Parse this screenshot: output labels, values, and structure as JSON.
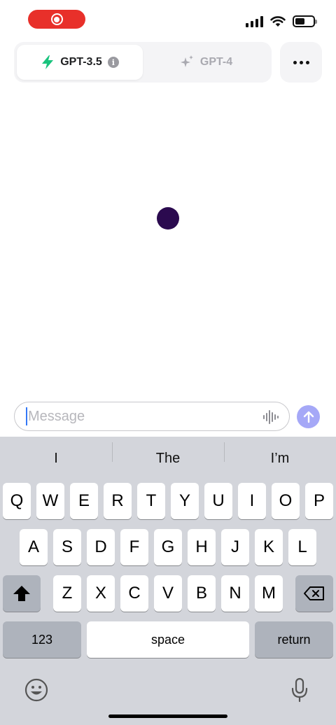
{
  "status": {
    "battery_level": 0.55
  },
  "models": {
    "active": {
      "label": "GPT-3.5",
      "icon": "bolt-icon",
      "color": "#19c37d"
    },
    "inactive": {
      "label": "GPT-4",
      "icon": "sparkles-icon"
    }
  },
  "composer": {
    "placeholder": "Message",
    "value": ""
  },
  "keyboard": {
    "suggestions": [
      "I",
      "The",
      "I’m"
    ],
    "row1": [
      "Q",
      "W",
      "E",
      "R",
      "T",
      "Y",
      "U",
      "I",
      "O",
      "P"
    ],
    "row2": [
      "A",
      "S",
      "D",
      "F",
      "G",
      "H",
      "J",
      "K",
      "L"
    ],
    "row3": [
      "Z",
      "X",
      "C",
      "V",
      "B",
      "N",
      "M"
    ],
    "numbers_label": "123",
    "space_label": "space",
    "return_label": "return"
  }
}
